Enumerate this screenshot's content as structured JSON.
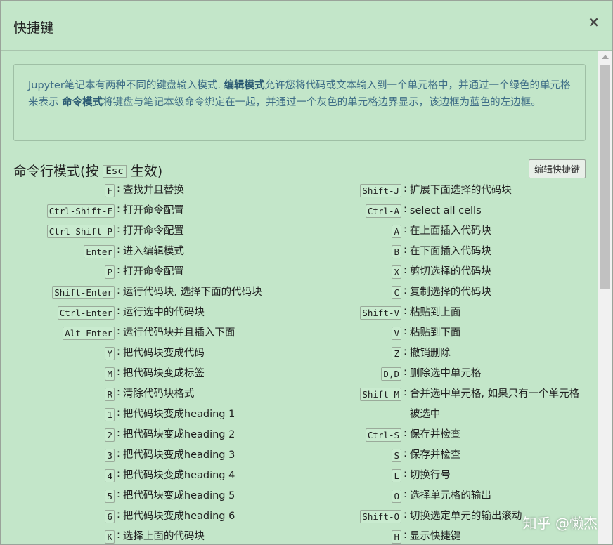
{
  "dialog": {
    "title": "快捷键",
    "close_label": "×"
  },
  "info": {
    "part1": "Jupyter笔记本有两种不同的键盘输入模式. ",
    "edit_mode": "编辑模式",
    "part2": "允许您将代码或文本输入到一个单元格中，并通过一个绿色的单元格来表示 ",
    "command_mode": "命令模式",
    "part3": "将键盘与笔记本级命令绑定在一起，并通过一个灰色的单元格边界显示，该边框为蓝色的左边框。"
  },
  "section": {
    "title_prefix": "命令行模式(按",
    "title_key": "Esc",
    "title_suffix": "生效)",
    "edit_button": "编辑快捷键"
  },
  "left_shortcuts": [
    {
      "keys": "F",
      "desc": "查找并且替换"
    },
    {
      "keys": "Ctrl-Shift-F",
      "desc": "打开命令配置"
    },
    {
      "keys": "Ctrl-Shift-P",
      "desc": "打开命令配置"
    },
    {
      "keys": "Enter",
      "desc": "进入编辑模式"
    },
    {
      "keys": "P",
      "desc": "打开命令配置"
    },
    {
      "keys": "Shift-Enter",
      "desc": "运行代码块, 选择下面的代码块"
    },
    {
      "keys": "Ctrl-Enter",
      "desc": "运行选中的代码块"
    },
    {
      "keys": "Alt-Enter",
      "desc": "运行代码块并且插入下面"
    },
    {
      "keys": "Y",
      "desc": "把代码块变成代码"
    },
    {
      "keys": "M",
      "desc": "把代码块变成标签"
    },
    {
      "keys": "R",
      "desc": "清除代码块格式"
    },
    {
      "keys": "1",
      "desc": "把代码块变成heading 1"
    },
    {
      "keys": "2",
      "desc": "把代码块变成heading 2"
    },
    {
      "keys": "3",
      "desc": "把代码块变成heading 3"
    },
    {
      "keys": "4",
      "desc": "把代码块变成heading 4"
    },
    {
      "keys": "5",
      "desc": "把代码块变成heading 5"
    },
    {
      "keys": "6",
      "desc": "把代码块变成heading 6"
    },
    {
      "keys": "K",
      "desc": "选择上面的代码块"
    }
  ],
  "right_shortcuts": [
    {
      "keys": "Shift-J",
      "desc": "扩展下面选择的代码块"
    },
    {
      "keys": "Ctrl-A",
      "desc": "select all cells"
    },
    {
      "keys": "A",
      "desc": "在上面插入代码块"
    },
    {
      "keys": "B",
      "desc": "在下面插入代码块"
    },
    {
      "keys": "X",
      "desc": "剪切选择的代码块"
    },
    {
      "keys": "C",
      "desc": "复制选择的代码块"
    },
    {
      "keys": "Shift-V",
      "desc": "粘贴到上面"
    },
    {
      "keys": "V",
      "desc": "粘贴到下面"
    },
    {
      "keys": "Z",
      "desc": "撤销删除"
    },
    {
      "keys": "D,D",
      "desc": "删除选中单元格"
    },
    {
      "keys": "Shift-M",
      "desc": "合并选中单元格, 如果只有一个单元格被选中",
      "tall": true
    },
    {
      "keys": "Ctrl-S",
      "desc": "保存并检查"
    },
    {
      "keys": "S",
      "desc": "保存并检查"
    },
    {
      "keys": "L",
      "desc": "切换行号"
    },
    {
      "keys": "O",
      "desc": "选择单元格的输出"
    },
    {
      "keys": "Shift-O",
      "desc": "切换选定单元的输出滚动"
    },
    {
      "keys": "H",
      "desc": "显示快捷键"
    }
  ],
  "watermark": "知乎 @懒杰"
}
